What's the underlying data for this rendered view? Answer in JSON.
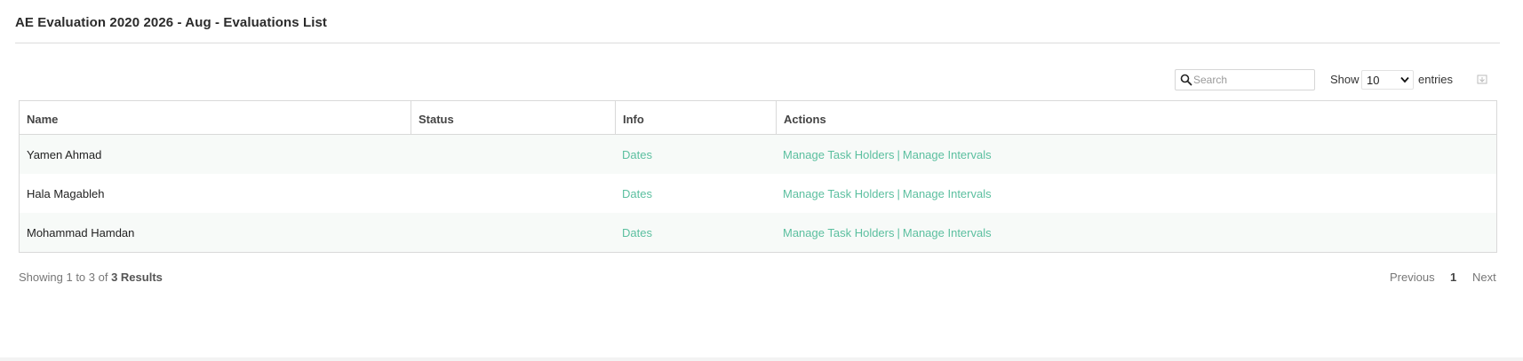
{
  "page": {
    "title": "AE Evaluation 2020 2026 - Aug - Evaluations List"
  },
  "toolbar": {
    "search_placeholder": "Search",
    "show_label": "Show",
    "page_size": "10",
    "entries_label": "entries"
  },
  "table": {
    "columns": [
      "Name",
      "Status",
      "Info",
      "Actions"
    ],
    "rows": [
      {
        "name": "Yamen Ahmad",
        "status": "",
        "info": "Dates",
        "action1": "Manage Task Holders",
        "sep": "|",
        "action2": "Manage Intervals"
      },
      {
        "name": "Hala Magableh",
        "status": "",
        "info": "Dates",
        "action1": "Manage Task Holders",
        "sep": "|",
        "action2": "Manage Intervals"
      },
      {
        "name": "Mohammad Hamdan",
        "status": "",
        "info": "Dates",
        "action1": "Manage Task Holders",
        "sep": "|",
        "action2": "Manage Intervals"
      }
    ]
  },
  "footer": {
    "showing_prefix": "Showing 1 to 3 of ",
    "results": "3 Results"
  },
  "pagination": {
    "previous": "Previous",
    "current": "1",
    "next": "Next"
  },
  "colors": {
    "link": "#5bbf9f",
    "row_stripe": "#f7faf8",
    "border": "#d9d9d9"
  },
  "icons": {
    "search": "search-icon",
    "dropdown": "chevron-down-icon",
    "export": "export-icon"
  }
}
